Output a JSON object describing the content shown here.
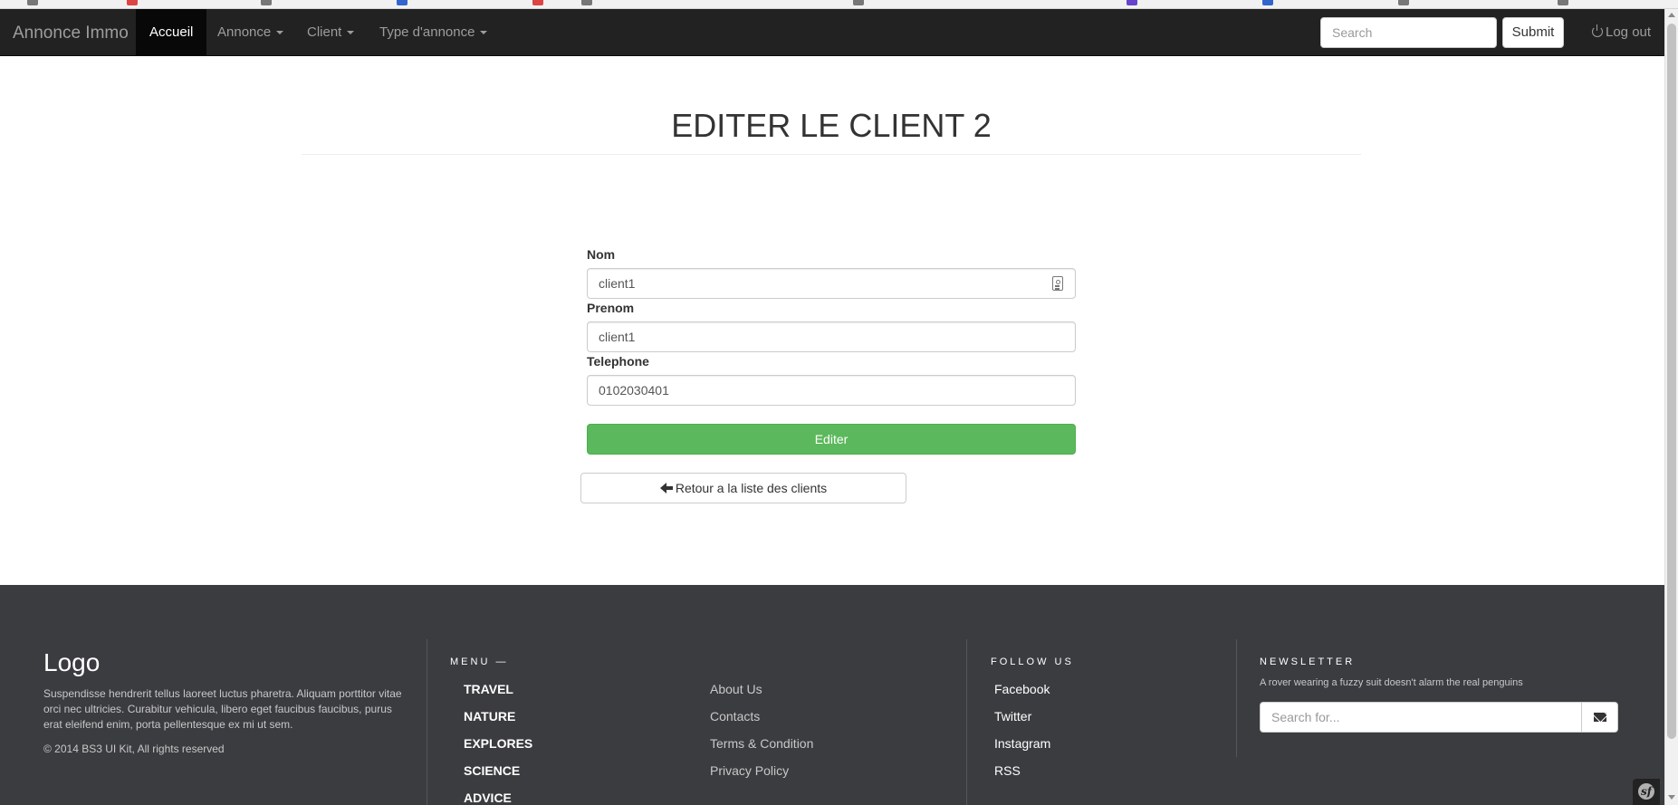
{
  "navbar": {
    "brand": "Annonce Immo",
    "items": [
      {
        "label": "Accueil",
        "active": true,
        "dropdown": false
      },
      {
        "label": "Annonce",
        "active": false,
        "dropdown": true
      },
      {
        "label": "Client",
        "active": false,
        "dropdown": true
      },
      {
        "label": "Type d'annonce",
        "active": false,
        "dropdown": true
      }
    ],
    "search_placeholder": "Search",
    "submit_label": "Submit",
    "logout_label": "Log out",
    "logout_icon": "power-icon"
  },
  "page": {
    "title": "EDITER LE CLIENT 2"
  },
  "form": {
    "fields": [
      {
        "label": "Nom",
        "value": "client1"
      },
      {
        "label": "Prenom",
        "value": "client1"
      },
      {
        "label": "Telephone",
        "value": "0102030401"
      }
    ],
    "submit_label": "Editer",
    "submit_color": "#5cb85c",
    "back_label": "Retour a la liste des clients",
    "back_icon": "arrow-left-icon"
  },
  "footer": {
    "logo": "Logo",
    "description": "Suspendisse hendrerit tellus laoreet luctus pharetra. Aliquam porttitor vitae orci nec ultricies. Curabitur vehicula, libero eget faucibus faucibus, purus erat eleifend enim, porta pellentesque ex mi ut sem.",
    "copyright": "© 2014 BS3 UI Kit, All rights reserved",
    "menu_heading": "MENU —",
    "menu_main": [
      "TRAVEL",
      "NATURE",
      "EXPLORES",
      "SCIENCE",
      "ADVICE"
    ],
    "menu_sub": [
      "About Us",
      "Contacts",
      "Terms & Condition",
      "Privacy Policy"
    ],
    "follow_heading": "FOLLOW US",
    "social": [
      "Facebook",
      "Twitter",
      "Instagram",
      "RSS"
    ],
    "newsletter_heading": "NEWSLETTER",
    "newsletter_text": "A rover wearing a fuzzy suit doesn't alarm the real penguins",
    "newsletter_placeholder": "Search for...",
    "newsletter_icon": "envelope-icon",
    "background_color": "#3b3c40"
  },
  "symfony_toolbar": {
    "icon": "symfony-icon",
    "glyph": "sf"
  }
}
